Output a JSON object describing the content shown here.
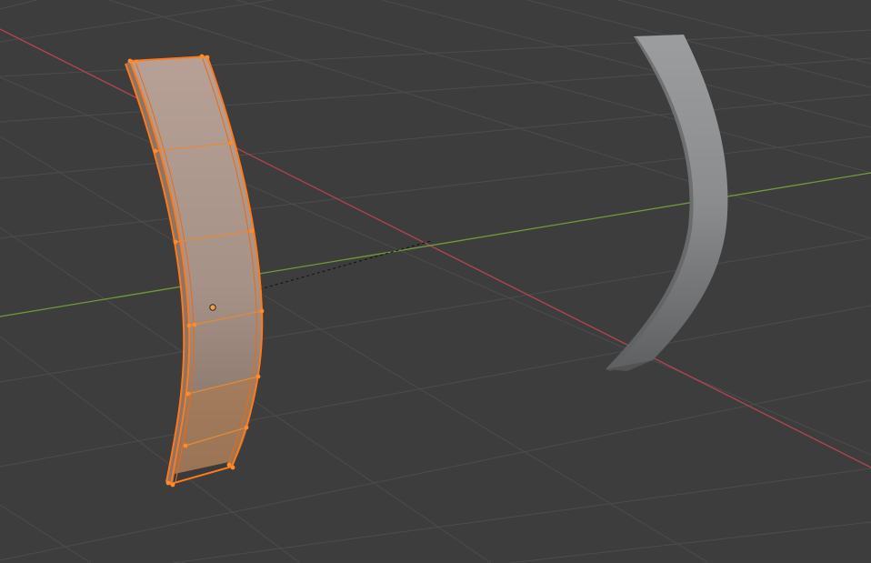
{
  "viewport": {
    "background": "#3d3d3d",
    "grid_color": "#4c4c4c",
    "x_axis_color": "#b2454f",
    "y_axis_color": "#6e9b3a"
  },
  "objects": [
    {
      "role": "selected mesh in edit mode",
      "shape": "curved flat strip",
      "outline_color": "#ff7a1a",
      "vertex_color": "#ff8a2a"
    },
    {
      "role": "unselected mesh",
      "shape": "curved flat strip",
      "fill_color": "#8e9092"
    }
  ],
  "origin_dot_color": "#f2a23c"
}
